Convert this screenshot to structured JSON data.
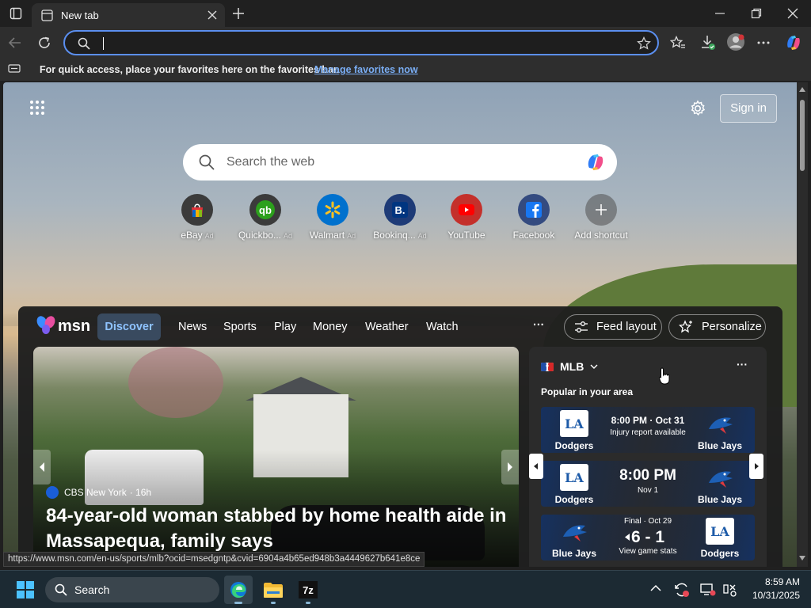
{
  "browser": {
    "tab_title": "New tab",
    "address_value": "",
    "favorites_bar_message": "For quick access, place your favorites here on the favorites bar.",
    "favorites_bar_link": "Manage favorites now"
  },
  "newtab": {
    "sign_in": "Sign in",
    "search_placeholder": "Search the web",
    "shortcuts": [
      {
        "label": "eBay",
        "ad": "Ad",
        "icon": "ebay-icon"
      },
      {
        "label": "Quickbo...",
        "ad": "Ad",
        "icon": "quickbooks-icon"
      },
      {
        "label": "Walmart",
        "ad": "Ad",
        "icon": "walmart-icon"
      },
      {
        "label": "Bookinq...",
        "ad": "Ad",
        "icon": "booking-icon"
      },
      {
        "label": "YouTube",
        "ad": "",
        "icon": "youtube-icon"
      },
      {
        "label": "Facebook",
        "ad": "",
        "icon": "facebook-icon"
      },
      {
        "label": "Add shortcut",
        "ad": "",
        "icon": "plus-icon"
      }
    ]
  },
  "feed": {
    "logo": "msn",
    "nav": [
      "Discover",
      "News",
      "Sports",
      "Play",
      "Money",
      "Weather",
      "Watch"
    ],
    "more": "···",
    "feed_layout": "Feed layout",
    "personalize": "Personalize",
    "hero": {
      "source": "CBS New York",
      "age": "· 16h",
      "title": "84-year-old woman stabbed by home health aide in Massapequa, family says"
    },
    "mlb": {
      "title": "MLB",
      "subtitle": "Popular in your area",
      "more": "···",
      "games": [
        {
          "away": "Dodgers",
          "home": "Blue Jays",
          "line1": "8:00 PM · Oct 31",
          "line2": "Injury report available",
          "left_logo": "LA",
          "right_logo": "blue-jays-logo"
        },
        {
          "away": "Dodgers",
          "home": "Blue Jays",
          "line1": "8:00 PM",
          "line2": "Nov 1",
          "left_logo": "LA",
          "right_logo": "blue-jays-logo"
        },
        {
          "away": "Blue Jays",
          "home": "Dodgers",
          "line0": "Final · Oct 29",
          "line1": "6 - 1",
          "line2": "View game stats",
          "left_logo": "blue-jays-logo",
          "right_logo": "LA"
        }
      ]
    }
  },
  "status_url": "https://www.msn.com/en-us/sports/mlb?ocid=msedgntp&cvid=6904a4b65ed948b3a4449627b641e8ce",
  "taskbar": {
    "search_label": "Search",
    "time": "8:59 AM",
    "date": "10/31/2025"
  },
  "colors": {
    "accent": "#5b8ff0",
    "link": "#7aaef5",
    "discover_bg": "#394a5f",
    "discover_text": "#8fc3ff"
  }
}
